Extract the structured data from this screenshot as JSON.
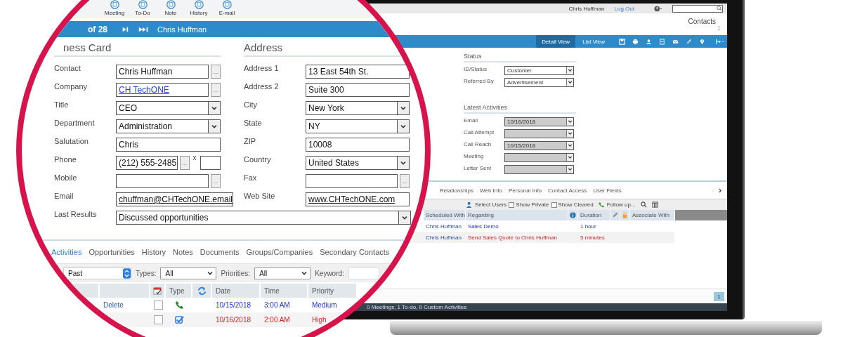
{
  "magnifier": {
    "toolbar": [
      "Meeting",
      "To-Do",
      "Note",
      "History",
      "E-mail"
    ],
    "record_bar": {
      "counter": "of 28",
      "name": "Chris Huffman"
    },
    "business_card": {
      "title": "ness Card",
      "fields": [
        {
          "label": "Contact",
          "value": "Chris Huffman",
          "kind": "lookup",
          "button": "...",
          "link": false
        },
        {
          "label": "Company",
          "value": "CH TechONE",
          "kind": "lookup",
          "button": "...",
          "link": true
        },
        {
          "label": "Title",
          "value": "CEO",
          "kind": "select",
          "link": false
        },
        {
          "label": "Department",
          "value": "Administration",
          "kind": "select",
          "link": false
        },
        {
          "label": "Salutation",
          "value": "Chris",
          "kind": "text",
          "link": false
        },
        {
          "label": "Phone",
          "value": "(212) 555-2485",
          "kind": "phone",
          "button": "...",
          "ext_label": "x",
          "link": false
        },
        {
          "label": "Mobile",
          "kind": "lookup",
          "button": "..."
        },
        {
          "label": "Email",
          "value": "chuffman@CHTechONE.email",
          "kind": "text",
          "link": true
        }
      ]
    },
    "address": {
      "title": "Address",
      "fields": [
        {
          "label": "Address 1",
          "value": "13 East 54th St.",
          "kind": "text",
          "link": false
        },
        {
          "label": "Address 2",
          "value": "Suite 300",
          "kind": "text",
          "link": false
        },
        {
          "label": "City",
          "value": "New York",
          "kind": "select",
          "link": false
        },
        {
          "label": "State",
          "value": "NY",
          "kind": "select",
          "link": false
        },
        {
          "label": "ZIP",
          "value": "10008",
          "kind": "text",
          "link": false
        },
        {
          "label": "Country",
          "value": "United States",
          "kind": "select",
          "link": false
        },
        {
          "label": "Fax",
          "kind": "lookup",
          "button": "..."
        },
        {
          "label": "Web Site",
          "value": "www.CHTechONE.com",
          "kind": "text",
          "link": true
        }
      ]
    },
    "last_results": {
      "label": "Last Results",
      "value": "Discussed opportunities",
      "kind": "select"
    },
    "tabs": [
      {
        "label": "Activities",
        "selected": true
      },
      {
        "label": "Opportunities",
        "selected": false
      },
      {
        "label": "History",
        "selected": false
      },
      {
        "label": "Notes",
        "selected": false
      },
      {
        "label": "Documents",
        "selected": false
      },
      {
        "label": "Groups/Companies",
        "selected": false
      },
      {
        "label": "Secondary Contacts",
        "selected": false
      }
    ],
    "filters": {
      "period": "Past",
      "types_label": "Types:",
      "types": "All",
      "priorities_label": "Priorities:",
      "priorities": "All",
      "keyword_label": "Keyword:"
    },
    "table": {
      "columns": [
        "Type",
        "Date",
        "Time",
        "Priority"
      ],
      "rows": [
        {
          "action": "Delete",
          "done": false,
          "kind": "call",
          "date": "10/15/2018",
          "time": "3:00 AM",
          "priority": "Medium",
          "overdue": false
        },
        {
          "done": false,
          "kind": "todo",
          "date": "10/16/2018",
          "time": "2:00 AM",
          "priority": "High",
          "overdue": true
        }
      ]
    }
  },
  "laptop": {
    "top_bar": {
      "user": "Chris Huffman",
      "logout": "Log Out"
    },
    "page_title": "Contacts",
    "views": [
      {
        "label": "Detail View",
        "selected": true
      },
      {
        "label": "List View",
        "selected": false
      }
    ],
    "status": {
      "title": "Status",
      "fields": [
        {
          "label": "ID/Status",
          "value": "Customer",
          "readonly": false
        },
        {
          "label": "Referred By",
          "value": "Advertisement",
          "readonly": false
        }
      ]
    },
    "latest": {
      "title": "Latest Activities",
      "fields": [
        {
          "label": "Email",
          "value": "10/16/2018",
          "readonly": true
        },
        {
          "label": "Call Attempt",
          "readonly": true
        },
        {
          "label": "Call Reach",
          "value": "10/15/2018",
          "readonly": true
        },
        {
          "label": "Meeting",
          "readonly": true
        },
        {
          "label": "Letter Sent",
          "readonly": true
        }
      ]
    },
    "tabs": [
      "Relationships",
      "Web Info",
      "Personal Info",
      "Contact Access",
      "User Fields"
    ],
    "filters": {
      "select_users": "Select Users",
      "options": [
        {
          "label": "Show Private",
          "checked": false
        },
        {
          "label": "Show Cleared",
          "checked": false
        }
      ],
      "follow_up": "Follow up..."
    },
    "table": {
      "columns": [
        "Scheduled With",
        "Regarding",
        "Duration",
        "Associate With"
      ],
      "rows": [
        {
          "scheduled_with": "Chris Huffman",
          "regarding": "Sales Demo",
          "duration": "1 hour",
          "overdue": false
        },
        {
          "scheduled_with": "Chris Huffman",
          "regarding": "Send Sales Quote to Chris Huffman",
          "duration": "5 minutes",
          "overdue": true
        }
      ]
    },
    "pager": "1",
    "status_bar": "0 Meetings, 1 To-do, 0 Custom Activities"
  }
}
